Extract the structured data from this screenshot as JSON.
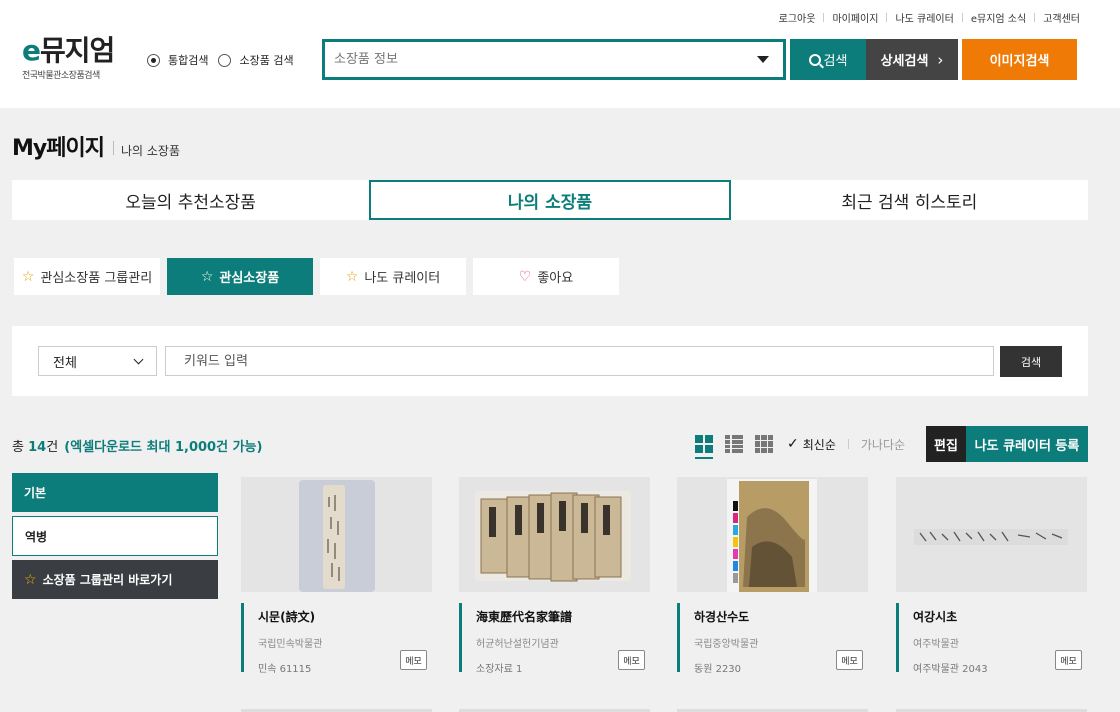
{
  "util_nav": [
    "로그아웃",
    "마이페이지",
    "나도 큐레이터",
    "e뮤지엄 소식",
    "고객센터"
  ],
  "logo": {
    "e": "e",
    "main": "뮤지엄",
    "sub": "전국박물관소장품검색"
  },
  "search_scope": {
    "options": [
      "통합검색",
      "소장품 검색"
    ],
    "selected": 0
  },
  "main_search": {
    "placeholder": "소장품 정보",
    "search_label": "검색",
    "detail_label": "상세검색",
    "image_label": "이미지검색"
  },
  "page": {
    "title": "My페이지",
    "subtitle": "나의 소장품"
  },
  "main_tabs": [
    "오늘의 추천소장품",
    "나의 소장품",
    "최근 검색 히스토리"
  ],
  "main_tab_active": 1,
  "sub_tabs": [
    "관심소장품 그룹관리",
    "관심소장품",
    "나도 큐레이터",
    "좋아요"
  ],
  "sub_tab_active": 1,
  "filter": {
    "select_value": "전체",
    "keyword_placeholder": "키워드 입력",
    "button": "검색"
  },
  "result": {
    "prefix": "총 ",
    "count": "14",
    "suffix": "건",
    "note": "(엑셀다운로드 최대 1,000건 가능)"
  },
  "sort": {
    "active": "최신순",
    "inactive": "가나다순"
  },
  "actions": {
    "edit": "편집",
    "nado": "나도 큐레이터 등록"
  },
  "groups": [
    "기본",
    "역병",
    "소장품 그룹관리 바로가기"
  ],
  "cards": [
    {
      "title": "시문(詩文)",
      "museum": "국립민속박물관",
      "code": "민속 61115",
      "memo": "메모"
    },
    {
      "title": "海東歷代名家筆譜",
      "museum": "허균허난설헌기념관",
      "code": "소장자료 1",
      "memo": "메모"
    },
    {
      "title": "하경산수도",
      "museum": "국립중앙박물관",
      "code": "동원 2230",
      "memo": "메모"
    },
    {
      "title": "여강시초",
      "museum": "여주박물관",
      "code": "여주박물관 2043",
      "memo": "메모"
    }
  ],
  "colors": {
    "accent": "#0c7d7a",
    "orange": "#f07a06",
    "dark": "#3a3d42"
  }
}
